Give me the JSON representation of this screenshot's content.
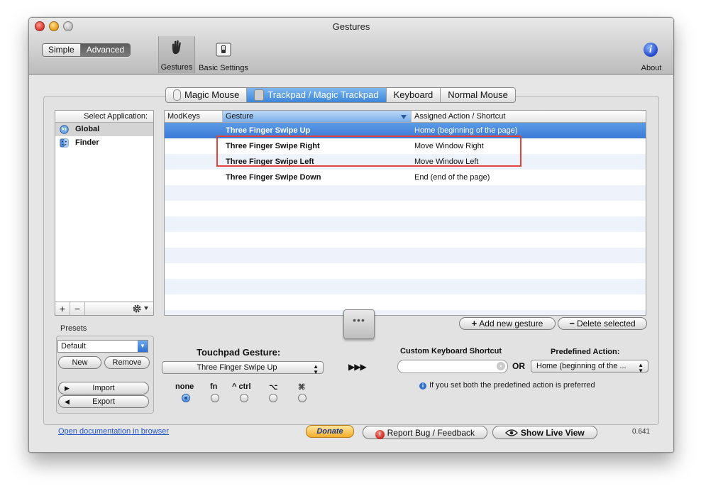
{
  "window": {
    "title": "Gestures"
  },
  "mode": {
    "simple": "Simple",
    "advanced": "Advanced"
  },
  "toolbar": {
    "gestures": "Gestures",
    "basic_settings": "Basic Settings",
    "about": "About",
    "about_icon_glyph": "i"
  },
  "tabs": [
    {
      "label": "Magic Mouse"
    },
    {
      "label": "Trackpad / Magic Trackpad"
    },
    {
      "label": "Keyboard"
    },
    {
      "label": "Normal Mouse"
    }
  ],
  "applist": {
    "header": "Select Application:",
    "items": [
      {
        "label": "Global"
      },
      {
        "label": "Finder"
      }
    ],
    "add": "+",
    "remove": "−"
  },
  "table": {
    "headers": {
      "modkeys": "ModKeys",
      "gesture": "Gesture",
      "action": "Assigned Action / Shortcut"
    },
    "rows": [
      {
        "modkeys": "",
        "gesture": "Three Finger Swipe Up",
        "action": "Home (beginning of the page)"
      },
      {
        "modkeys": "",
        "gesture": "Three Finger Swipe Right",
        "action": "Move Window Right"
      },
      {
        "modkeys": "",
        "gesture": "Three Finger Swipe Left",
        "action": "Move Window Left"
      },
      {
        "modkeys": "",
        "gesture": "Three Finger Swipe Down",
        "action": "End (end of the page)"
      }
    ]
  },
  "gesture_actions": {
    "add": "Add new gesture",
    "delete": "Delete selected",
    "drag_handle": "•••"
  },
  "presets": {
    "label": "Presets",
    "selected": "Default",
    "new": "New",
    "remove": "Remove",
    "import": "Import",
    "export": "Export"
  },
  "editor": {
    "touchpad_label": "Touchpad Gesture:",
    "touchpad_value": "Three Finger Swipe Up",
    "arrows": "▶▶▶",
    "modifiers": [
      {
        "label": "none",
        "selected": true
      },
      {
        "label": "fn",
        "selected": false
      },
      {
        "label": "^ ctrl",
        "selected": false
      },
      {
        "label": "⌥",
        "selected": false
      },
      {
        "label": "⌘",
        "selected": false
      }
    ],
    "custom_shortcut_label": "Custom Keyboard Shortcut",
    "custom_shortcut_value": "",
    "or": "OR",
    "predefined_label": "Predefined Action:",
    "predefined_value": "Home (beginning of the ...",
    "info": "If you set both the predefined action is preferred"
  },
  "footer": {
    "doc_link": "Open documentation in browser",
    "donate": "Donate",
    "report_bug": "Report Bug / Feedback",
    "live_view": "Show Live View",
    "version": "0.641"
  },
  "colors": {
    "selection": "#3b7ad6",
    "highlight_box": "#e0443a",
    "accent_blue": "#2f6fd0"
  }
}
